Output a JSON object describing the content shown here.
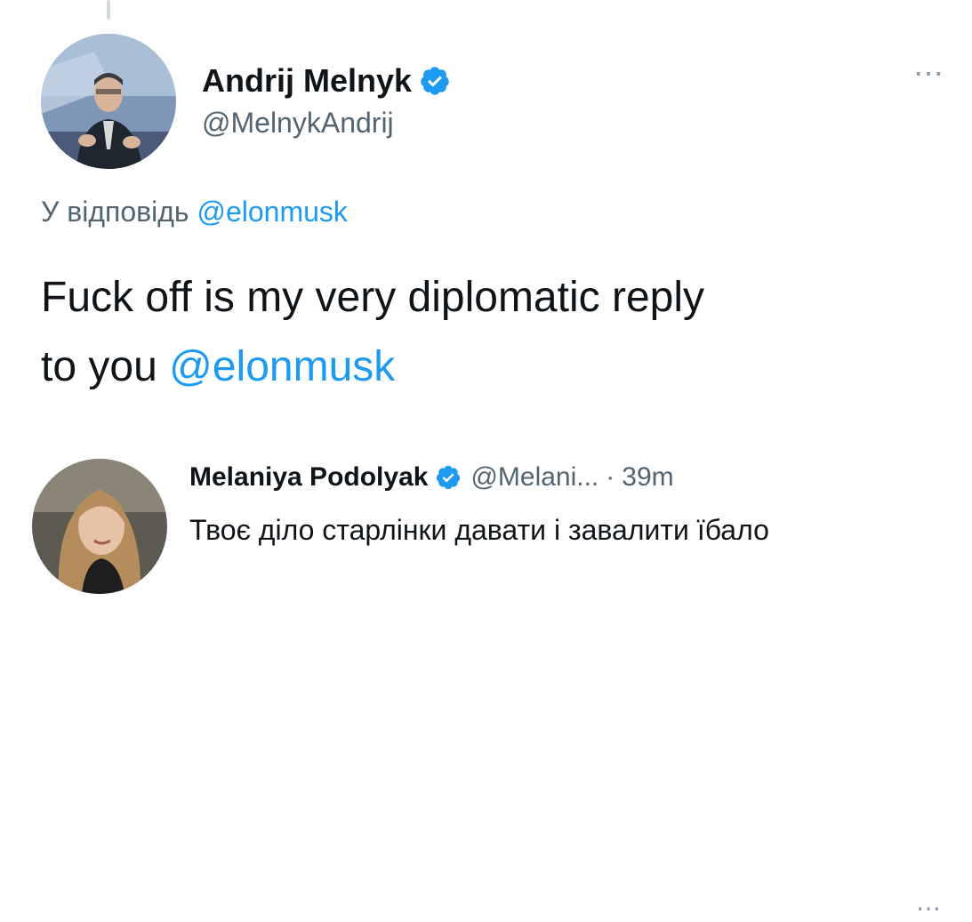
{
  "main_tweet": {
    "author_name": "Andrij Melnyk",
    "author_handle": "@MelnykAndrij",
    "reply_prefix": "У відповідь",
    "reply_mention": "@elonmusk",
    "text_line1": "Fuck off is my very diplomatic reply",
    "text_line2_prefix": "to you",
    "text_mention": "@elonmusk",
    "more_icon": "⋯"
  },
  "reply_tweet": {
    "author_name": "Melaniya Podolyak",
    "author_handle": "@Melani...",
    "separator": "·",
    "timestamp": "39m",
    "text": "Твоє діло старлінки давати і завалити їбало",
    "more_icon": "⋯"
  },
  "colors": {
    "link": "#1d9bf0",
    "verified": "#1d9bf0",
    "secondary_text": "#536471"
  },
  "icons": {
    "verified": "verified-badge-icon",
    "more": "more-options-icon"
  }
}
